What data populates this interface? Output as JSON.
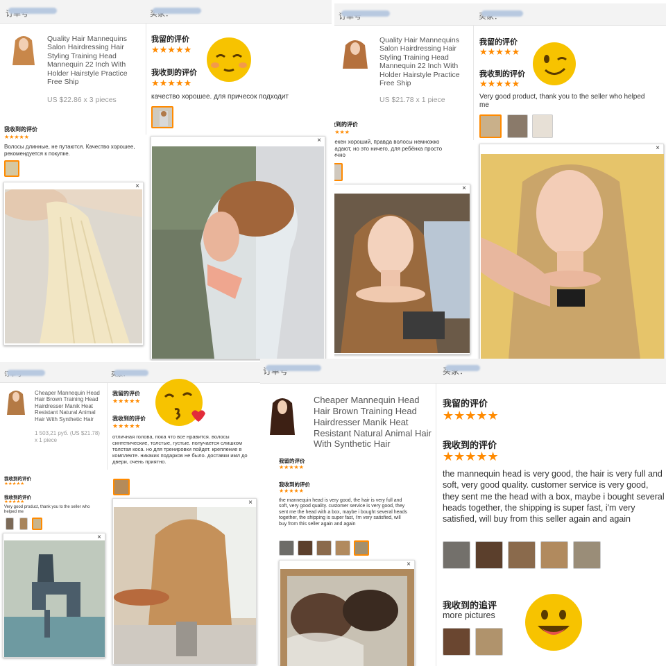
{
  "labels": {
    "order": "订单号",
    "buyer": "买家：",
    "seller_review": "我留的评价",
    "got_review": "我收到的评价",
    "followup": "我收到的追评"
  },
  "stars": "★★★★★",
  "close": "×",
  "p1": {
    "product": "Quality Hair Mannequins Salon Hairdressing Hair Styling Training Head Mannequin 22 Inch With Holder Hairstyle Practice Free Ship",
    "price": "US $22.86 x 3 pieces",
    "review_text": "качество хорошее. для причесок подходит",
    "left_review": "Волосы длинные, не путаются. Качество хорошее, рекомендуется к покупке."
  },
  "p2": {
    "product": "Quality Hair Mannequins Salon Hairdressing Hair Styling Training Head Mannequin 22 Inch With Holder Hairstyle Practice Free Ship",
    "price": "US $21.78 x 1 piece",
    "review_text": "Very good product, thank you to the seller who helped me",
    "left_review": "манекен хороший, правда волосы немножко выпадают, но это ничего, для ребёнка просто отлично"
  },
  "p3": {
    "product": "Cheaper Mannequin Head Hair Brown Training Head Hairdresser Manik Heat Resistant Natural Animal Hair With Synthetic Hair",
    "price": "1 503,21 руб. (US $21.78) x 1 piece",
    "review_text": "отличная голова, пока что все нравится. волосы синтетические, толстые, густые. получается слишком толстая коса. но для тренировки пойдет. крепление в комплекте. никаких подарков не было. доставки имл до двери, очень приятно.",
    "left_review": "Very good product, thank you to the seller who helped me"
  },
  "p4": {
    "product": "Cheaper Mannequin Head Hair Brown Training Head Hairdresser Manik Heat Resistant Natural Animal Hair With Synthetic Hair",
    "review_text": "the mannequin head is very good, the hair is very full and soft, very good quality. customer service is very good, they sent me the head with a box, maybe i bought several heads together, the shipping is super fast, i'm very satisfied, will buy from this seller again and again",
    "more": "more pictures"
  },
  "colors": {
    "star": "#ff8a00",
    "emoji": "#f7c300",
    "header_bg": "#f3f3f3"
  }
}
